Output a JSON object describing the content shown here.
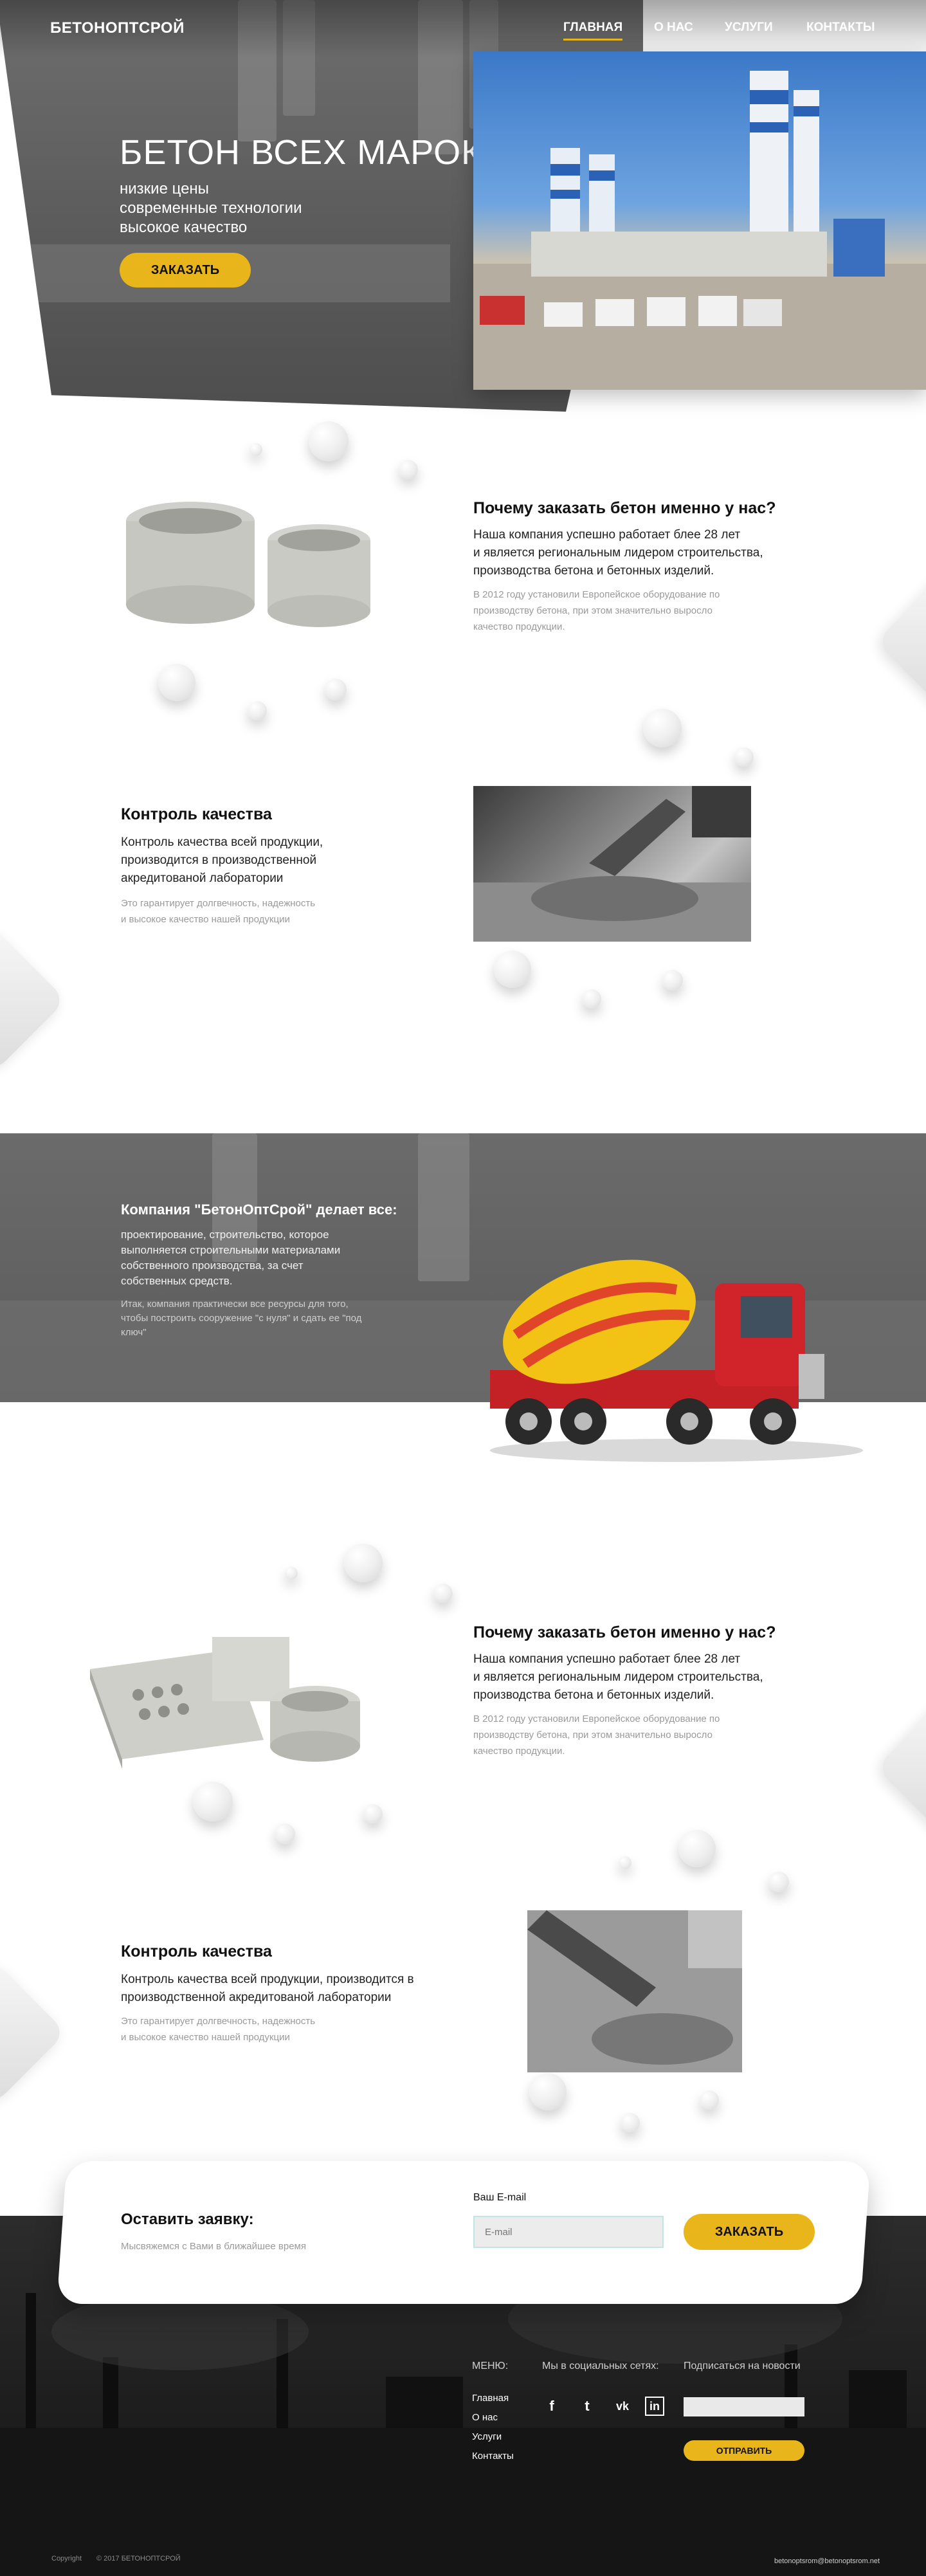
{
  "header": {
    "logo": "БЕТОНОПТСРОЙ",
    "nav": [
      "ГЛАВНАЯ",
      "О НАС",
      "УСЛУГИ",
      "КОНТАКТЫ"
    ]
  },
  "hero": {
    "title": "БЕТОН ВСЕХ МАРОК",
    "lines": [
      "низкие цены",
      "современные технологии",
      "высокое качество"
    ],
    "cta": "ЗАКАЗАТЬ"
  },
  "section1": {
    "title": "Почему заказать бетон именно у нас?",
    "main": [
      "Наша компания успешно работает блее 28 лет",
      "и является региональным лидером строительства,",
      "производства бетона и бетонных изделий."
    ],
    "muted": [
      "В 2012 году установили Европейское оборудование по",
      "производству бетона, при этом значительно выросло",
      "качество продукции."
    ]
  },
  "section2": {
    "title": "Контроль качества",
    "main": [
      "Контроль качества всей продукции,",
      "производится в производственной",
      "акредитованой лаборатории"
    ],
    "muted": [
      "Это гарантирует долгвечность, надежность",
      "и высокое качество нашей продукции"
    ]
  },
  "band": {
    "title": "Компания \"БетонОптСрой\" делает все:",
    "main": [
      "проектирование, строительство, которое",
      "выполняется строительными материалами",
      "собственного производства, за счет",
      "собственных средств."
    ],
    "muted": [
      "Итак, компания практически все ресурсы для того,",
      "чтобы построить сооружение \"с нуля\" и сдать ее \"под",
      "ключ\""
    ]
  },
  "section3": {
    "title": "Почему заказать бетон именно у нас?",
    "main": [
      "Наша компания успешно работает блее 28 лет",
      "и является региональным лидером строительства,",
      "производства бетона и бетонных изделий."
    ],
    "muted": [
      "В 2012 году установили Европейское оборудование по",
      "производству бетона, при этом значительно выросло",
      "качество продукции."
    ]
  },
  "section4": {
    "title": "Контроль качества",
    "main": [
      "Контроль качества всей продукции, производится в",
      "производственной акредитованой лаборатории"
    ],
    "muted": [
      "Это гарантирует долгвечность, надежность",
      "и высокое качество нашей продукции"
    ]
  },
  "order": {
    "title": "Оставить заявку:",
    "subtitle": "Мысвяжемся с Вами в ближайшее время",
    "email_label": "Ваш E-mail",
    "email_placeholder": "E-mail",
    "button": "ЗАКАЗАТЬ"
  },
  "footer": {
    "menu_title": "МЕНЮ:",
    "menu": [
      "Главная",
      "О нас",
      "Услуги",
      "Контакты"
    ],
    "social_title": "Мы в социальных сетях:",
    "subscribe_title": "Подписаться на новости",
    "subscribe_button": "ОТПРАВИТЬ",
    "copyright_left": "Copyright",
    "copyright_right": "© 2017 БЕТОНОПТСРОЙ",
    "email": "betonoptsrom@betonoptsrom.net",
    "social_icons": [
      "facebook-icon",
      "twitter-icon",
      "vk-icon",
      "linkedin-icon"
    ]
  },
  "colors": {
    "accent": "#e8b61a",
    "dark": "#5e5e5e"
  }
}
